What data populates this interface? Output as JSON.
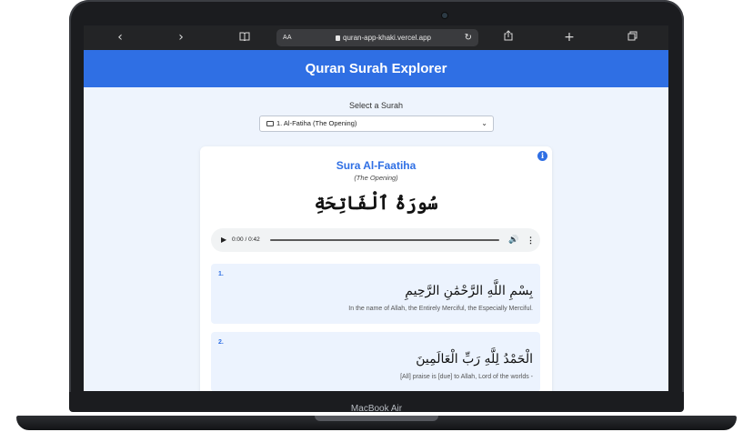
{
  "device": {
    "label": "MacBook Air"
  },
  "browser": {
    "back_icon": "chevron-left-icon",
    "forward_icon": "chevron-right-icon",
    "text_size_label": "AA",
    "url": "quran-app-khaki.vercel.app"
  },
  "app": {
    "title": "Quran Surah Explorer",
    "accent_color": "#2f6fe4"
  },
  "selector": {
    "label": "Select a Surah",
    "selected": "1. Al-Fatiha (The Opening)"
  },
  "surah": {
    "title": "Sura Al-Faatiha",
    "subtitle": "(The Opening)",
    "arabic_name": "سُورَةُ ٱلْفَاتِحَةِ"
  },
  "audio": {
    "time": "0:00 / 0:42"
  },
  "ayahs": [
    {
      "number": "1.",
      "arabic": "بِسْمِ اللَّهِ الرَّحْمَٰنِ الرَّحِيمِ",
      "translation": "In the name of Allah, the Entirely Merciful, the Especially Merciful."
    },
    {
      "number": "2.",
      "arabic": "الْحَمْدُ لِلَّهِ رَبِّ الْعَالَمِينَ",
      "translation": "[All] praise is [due] to Allah, Lord of the worlds -"
    }
  ]
}
